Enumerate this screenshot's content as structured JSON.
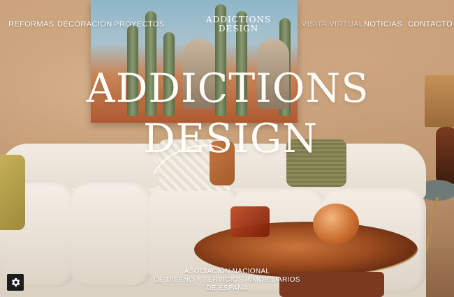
{
  "nav": {
    "items": [
      {
        "label": "REFORMAS"
      },
      {
        "label": "DECORACIÓN"
      },
      {
        "label": "PROYECTOS"
      },
      {
        "label": "VISITA VIRTUAL"
      },
      {
        "label": "NOTICIAS"
      },
      {
        "label": "CONTACTO"
      }
    ]
  },
  "hero": {
    "brand_line1": "ADDICTIONS",
    "brand_line2": "DESIGN",
    "painting_logo_line1": "ADDICTIONS",
    "painting_logo_line2": "DESIGN"
  },
  "footer_text": {
    "line1": "ASOCIACIÓN NACIONAL",
    "line2": "DE DISEÑO Y SERVICIOS INMOBILIARIOS",
    "line3": "DE ESPAÑA"
  },
  "settings": {
    "icon": "gear-icon"
  },
  "colors": {
    "text": "#ffffff",
    "brand": "#fffdf8",
    "button_bg": "#1c1c1c"
  }
}
